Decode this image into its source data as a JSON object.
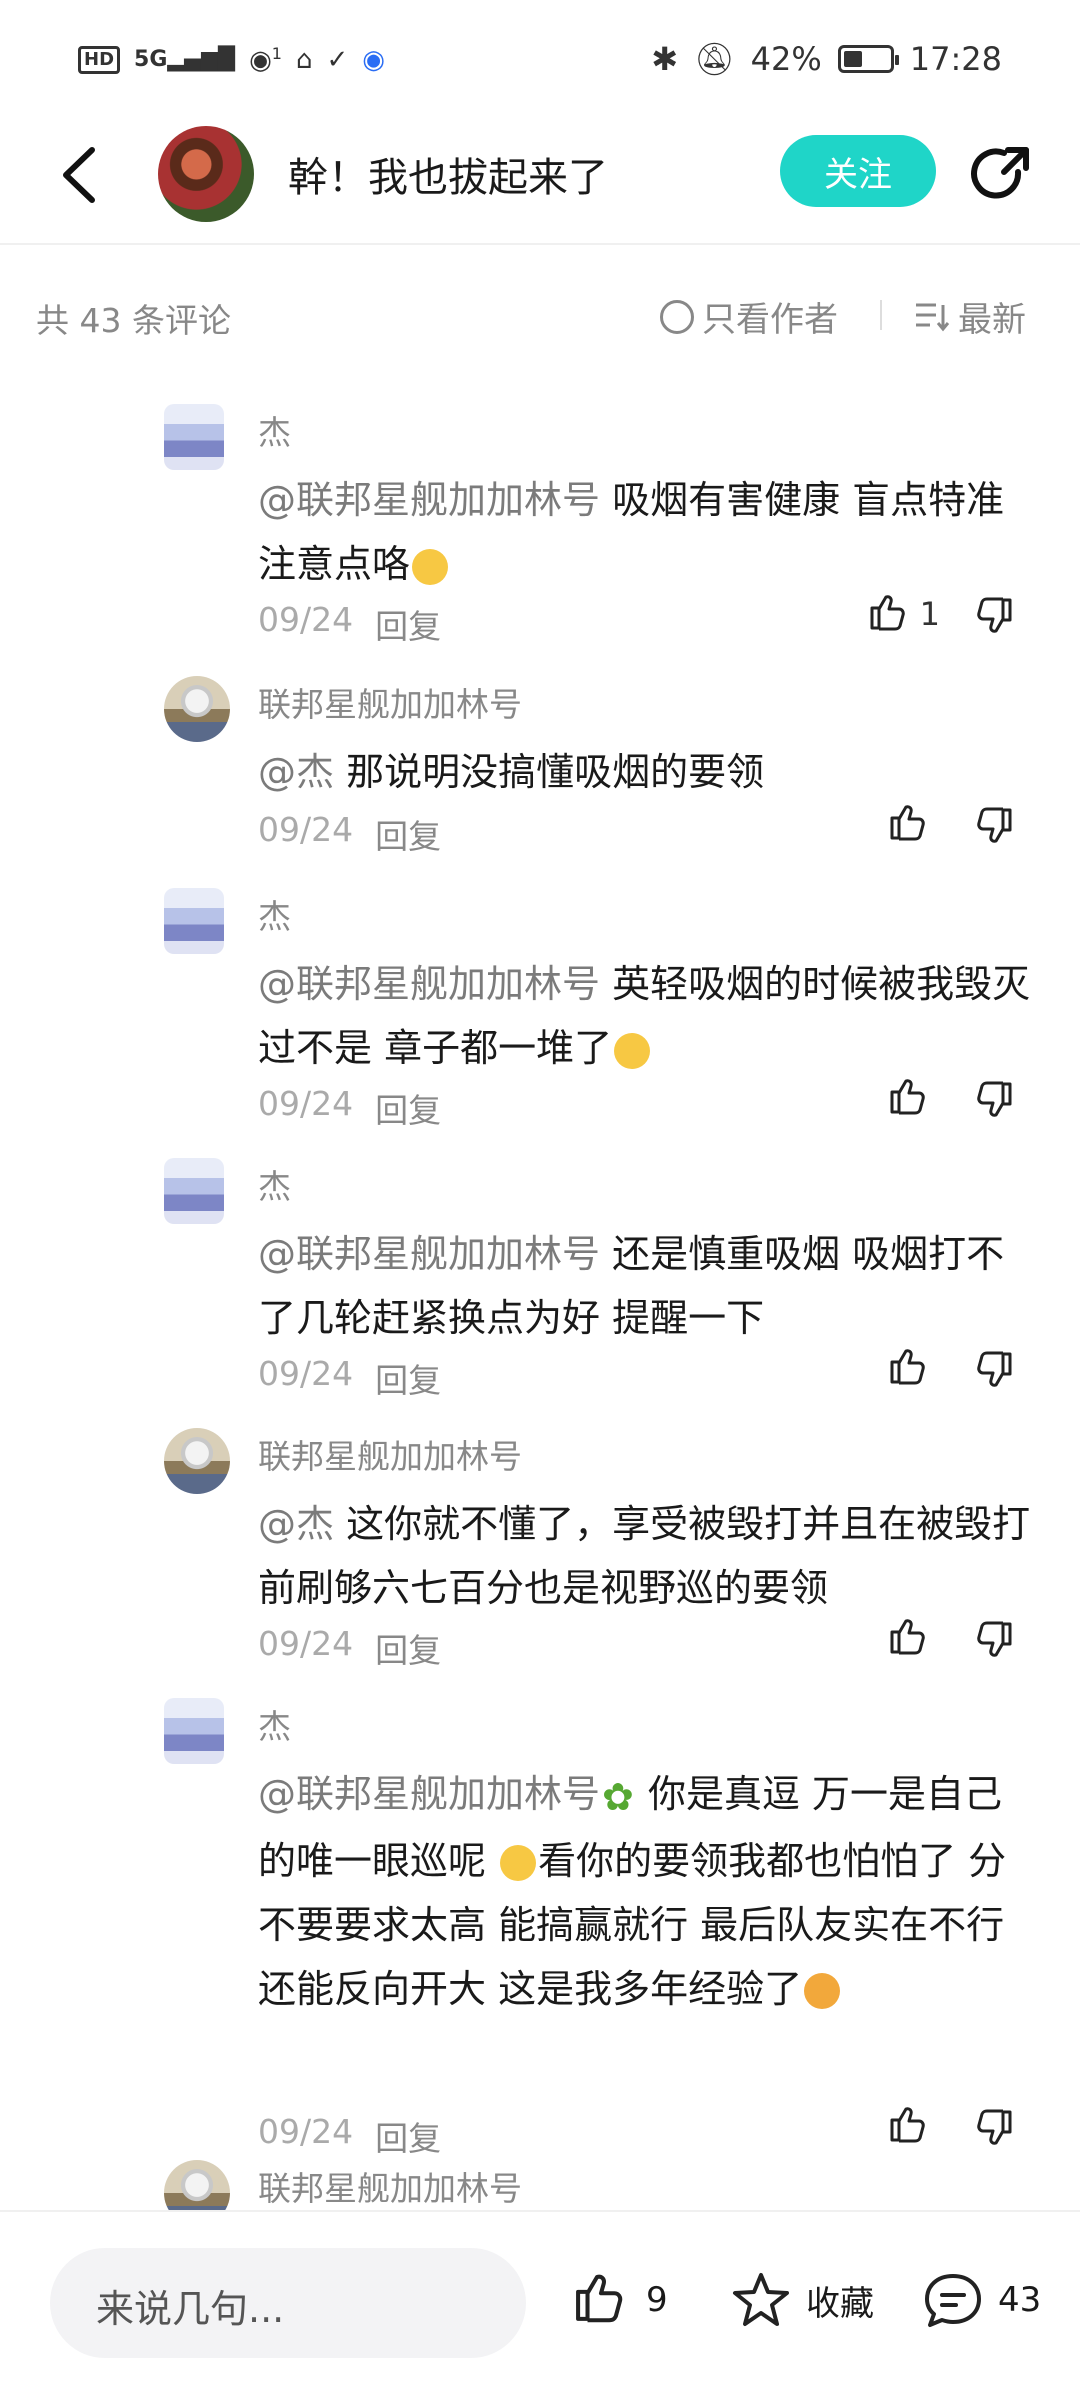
{
  "status_bar": {
    "left_badges": [
      "HD",
      "5G",
      "1"
    ],
    "battery": "42%",
    "battery_level": 0.42,
    "time": "17:28"
  },
  "header": {
    "title": "幹！我也拔起来了",
    "follow_label": "关注"
  },
  "filter": {
    "count_label": "共 43 条评论",
    "author_only_label": "只看作者",
    "sort_label": "最新"
  },
  "comments": [
    {
      "name": "杰",
      "mention": "@联邦星舰加加林号",
      "text": " 吸烟有害健康  盲点特准  注意点咯",
      "date": "09/24",
      "reply": "回复",
      "likes": "1"
    },
    {
      "name": "联邦星舰加加林号",
      "mention": "@杰",
      "text": " 那说明没搞懂吸烟的要领",
      "date": "09/24",
      "reply": "回复",
      "likes": ""
    },
    {
      "name": "杰",
      "mention": "@联邦星舰加加林号",
      "text": " 英轻吸烟的时候被我毁灭过不是  章子都一堆了",
      "date": "09/24",
      "reply": "回复",
      "likes": ""
    },
    {
      "name": "杰",
      "mention": "@联邦星舰加加林号",
      "text": " 还是慎重吸烟  吸烟打不了几轮赶紧换点为好  提醒一下",
      "date": "09/24",
      "reply": "回复",
      "likes": ""
    },
    {
      "name": "联邦星舰加加林号",
      "mention": "@杰",
      "text": " 这你就不懂了，享受被毁打并且在被毁打前刷够六七百分也是视野巡的要领",
      "date": "09/24",
      "reply": "回复",
      "likes": ""
    },
    {
      "name": "杰",
      "mention": "@联邦星舰加加林号",
      "text_a": "   你是真逗  万一是自己的唯一眼巡呢  ",
      "text_b": "看你的要领我都也怕怕了  分不要要求太高  能搞赢就行  最后队友实在不行还能反向开大  这是我多年经验了",
      "date": "09/24",
      "reply": "回复",
      "likes": ""
    },
    {
      "name": "联邦星舰加加林号"
    }
  ],
  "bottom": {
    "input_placeholder": "来说几句...",
    "like_count": "9",
    "fav_label": "收藏",
    "comment_count": "43"
  },
  "colors": {
    "accent": "#1fd5c8",
    "muted_text": "#888888",
    "date_text": "#aaaaaa"
  }
}
